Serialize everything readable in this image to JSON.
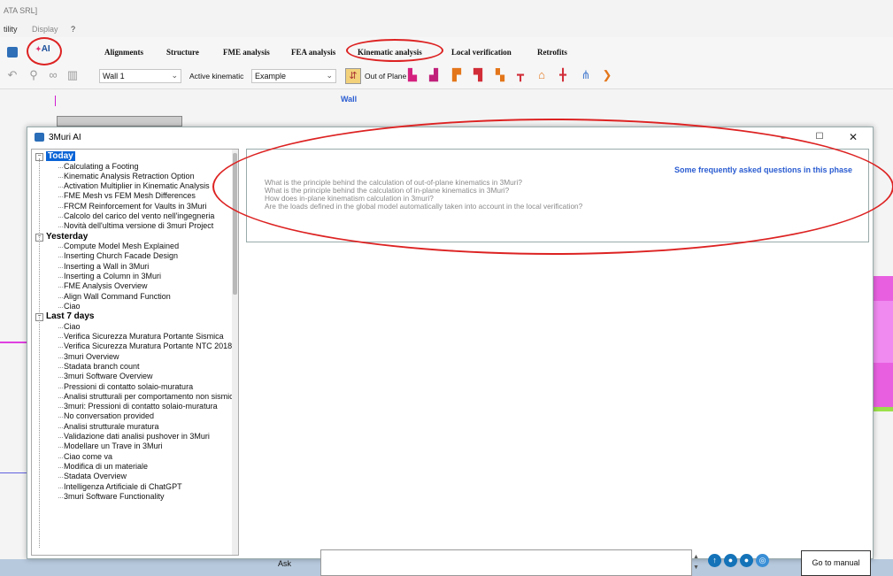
{
  "window": {
    "title_fragment": "ATA SRL]"
  },
  "menu": {
    "items": [
      "tility",
      "Display",
      "?"
    ]
  },
  "ribbon": {
    "ai_label": "AI",
    "tabs": [
      "Alignments",
      "Structure",
      "FME analysis",
      "FEA analysis",
      "Kinematic analysis",
      "Local verification",
      "Retrofits"
    ],
    "active_tab": "Kinematic analysis"
  },
  "toolbar": {
    "wall_combo": "Wall 1",
    "active_kinematic_label": "Active kinematic",
    "kinematic_combo": "Example",
    "out_of_plane_label": "Out of Plane"
  },
  "canvas": {
    "wall_label": "Wall"
  },
  "dialog": {
    "title": "3Muri AI",
    "buttons": {
      "minimize": "–",
      "maximize": "☐",
      "close": "✕"
    }
  },
  "history": [
    {
      "group": "Today",
      "items": [
        "Calculating a Footing",
        "Kinematic Analysis Retraction Option",
        "Activation Multiplier in Kinematic Analysis",
        "FME Mesh vs FEM Mesh Differences",
        "FRCM Reinforcement for Vaults in 3Muri",
        "Calcolo del carico del vento nell'ingegneria",
        "Novità dell'ultima versione di 3muri Project"
      ]
    },
    {
      "group": "Yesterday",
      "items": [
        "Compute Model Mesh Explained",
        "Inserting Church Facade Design",
        "Inserting a Wall in 3Muri",
        "Inserting a Column in 3Muri",
        "FME Analysis Overview",
        "Align Wall Command Function",
        "Ciao"
      ]
    },
    {
      "group": "Last 7 days",
      "items": [
        "Ciao",
        "Verifica Sicurezza Muratura Portante Sismica",
        "Verifica Sicurezza Muratura Portante NTC 2018",
        "3muri Overview",
        "Stadata branch count",
        "3muri Software Overview",
        "Pressioni di contatto solaio-muratura",
        "Analisi strutturali per comportamento non sismico",
        "3muri: Pressioni di contatto solaio-muratura",
        "No conversation provided",
        "Analisi strutturale muratura",
        "Validazione dati analisi pushover in 3Muri",
        "Modellare un Trave in 3Muri",
        "Ciao come va",
        "Modifica di un materiale",
        "Stadata Overview",
        "Intelligenza Artificiale di ChatGPT",
        "3muri Software Functionality"
      ]
    }
  ],
  "faq": {
    "title": "Some frequently asked questions in this phase",
    "questions": [
      "What is the principle behind the calculation of out-of-plane kinematics in 3Muri?",
      "What is the principle behind the calculation of in-plane kinematics in 3Muri?",
      "How does in-plane kinematism calculation in 3muri?",
      "Are the loads defined in the global model automatically taken into account in the local verification?"
    ]
  },
  "ask": {
    "label": "Ask",
    "goto_manual": "Go to manual"
  }
}
